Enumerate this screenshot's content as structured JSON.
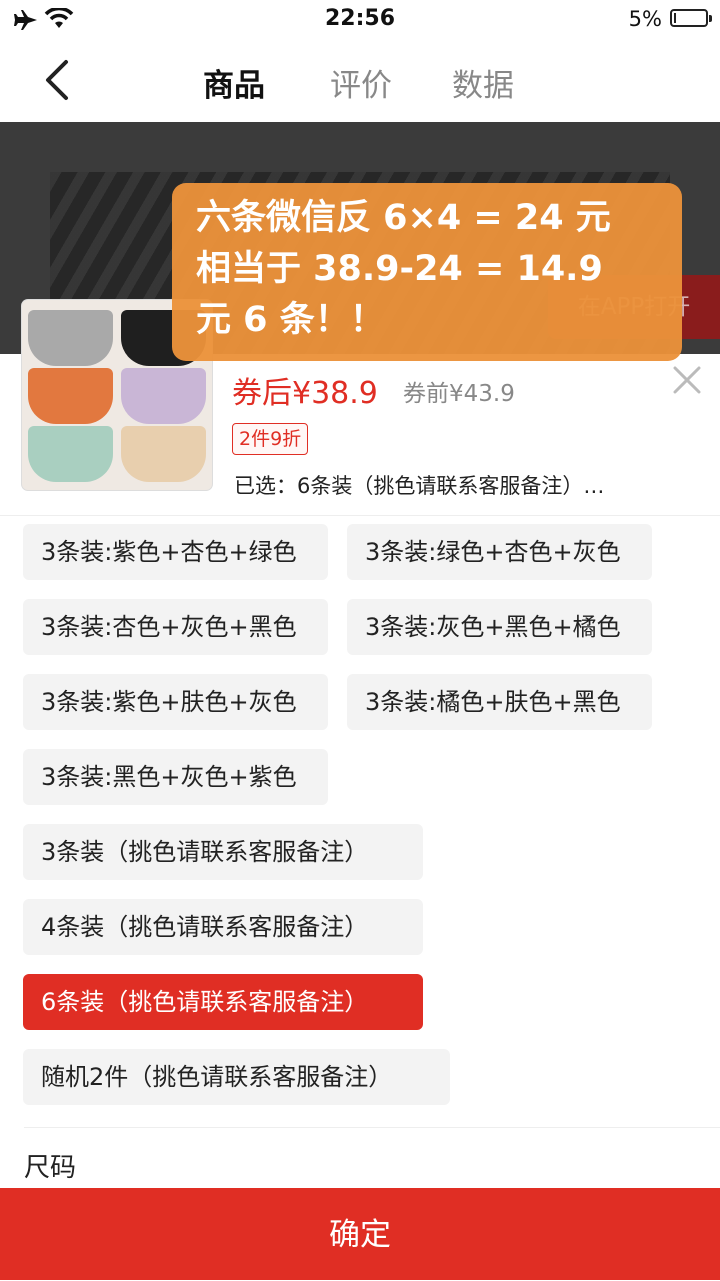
{
  "status_bar": {
    "time": "22:56",
    "battery_percent": "5%",
    "battery_level": 0.05,
    "icons": [
      "airplane-icon",
      "wifi-icon",
      "battery-icon"
    ]
  },
  "nav": {
    "tabs": [
      {
        "label": "商品",
        "active": true
      },
      {
        "label": "评价",
        "active": false
      },
      {
        "label": "数据",
        "active": false
      }
    ]
  },
  "banner": {
    "open_app": "在APP打开"
  },
  "product": {
    "price_after": "券后¥38.9",
    "price_before": "券前¥43.9",
    "discount_tag": "2件9折",
    "selected": "已选：6条装（挑色请联系客服备注）…"
  },
  "options": [
    {
      "label": "3条装:紫色+杏色+绿色",
      "selected": false
    },
    {
      "label": "3条装:绿色+杏色+灰色",
      "selected": false
    },
    {
      "label": "3条装:杏色+灰色+黑色",
      "selected": false
    },
    {
      "label": "3条装:灰色+黑色+橘色",
      "selected": false
    },
    {
      "label": "3条装:紫色+肤色+灰色",
      "selected": false
    },
    {
      "label": "3条装:橘色+肤色+黑色",
      "selected": false
    },
    {
      "label": "3条装:黑色+灰色+紫色",
      "selected": false
    },
    {
      "label": "3条装（挑色请联系客服备注）",
      "selected": false
    },
    {
      "label": "4条装（挑色请联系客服备注）",
      "selected": false
    },
    {
      "label": "6条装（挑色请联系客服备注）",
      "selected": true
    },
    {
      "label": "随机2件（挑色请联系客服备注）",
      "selected": false
    }
  ],
  "size_label": "尺码",
  "confirm_label": "确定",
  "annotation": {
    "lines": [
      "六条微信反 6×4 = 24 元",
      "相当于 38.9-24 = 14.9",
      "元 6 条！！"
    ]
  },
  "colors": {
    "accent": "#e02e24",
    "annotation_bg": "#eb923a"
  }
}
